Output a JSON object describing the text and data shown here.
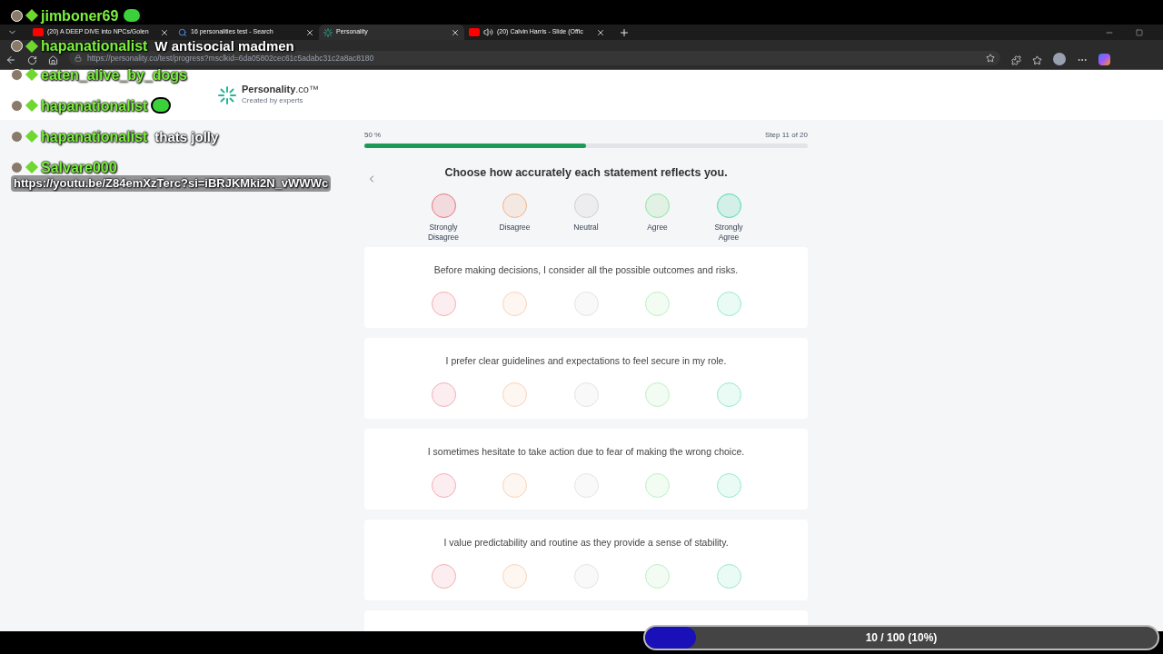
{
  "browser": {
    "tabs": [
      {
        "title": "(20) A DEEP DIVE into NPCs/Golen",
        "kind": "video",
        "selected": false
      },
      {
        "title": "16 personalities test - Search",
        "kind": "search",
        "selected": false
      },
      {
        "title": "Personality",
        "kind": "site",
        "selected": true
      },
      {
        "title": "(20) Calvin Harris - Slide (Offic",
        "kind": "video-audio",
        "selected": false
      }
    ],
    "url": "https://personality.co/test/progress?msclkid=6da05802cec61c5adabc31c2a8ac8180"
  },
  "chat": [
    {
      "user": "jimboner69",
      "emote": true
    },
    {
      "user": "hapanationalist",
      "text": "W antisocial madmen"
    },
    {
      "user": "eaten_alive_by_dogs"
    },
    {
      "user": "hapanationalist",
      "emote": true
    },
    {
      "user": "hapanationalist",
      "text": "thats jolly"
    },
    {
      "user": "Salvare000",
      "text": "https://youtu.be/Z84emXzTerc?si=iBRJKMki2N_vWWWc",
      "below": true
    }
  ],
  "page": {
    "logo": {
      "name": "Personality",
      "suffix": ".co™",
      "tagline": "Created by experts"
    },
    "progress": {
      "percent": "50 %",
      "step": "Step 11 of 20",
      "level": 0.5
    },
    "prompt": "Choose how accurately each statement reflects you.",
    "scale": [
      {
        "label": "Strongly Disagree",
        "color": "#e8737f"
      },
      {
        "label": "Disagree",
        "color": "#f1b48a"
      },
      {
        "label": "Neutral",
        "color": "#cfcfd3"
      },
      {
        "label": "Agree",
        "color": "#8fe39a"
      },
      {
        "label": "Strongly Agree",
        "color": "#4fd8a8"
      }
    ],
    "statements": [
      {
        "text": "Before making decisions, I consider all the possible outcomes and risks.",
        "options": [
          {
            "selected": false
          },
          {
            "selected": false
          },
          {
            "selected": false
          },
          {
            "selected": false
          },
          {
            "selected": false
          }
        ]
      },
      {
        "text": "I prefer clear guidelines and expectations to feel secure in my role.",
        "options": [
          {
            "selected": false
          },
          {
            "selected": false
          },
          {
            "selected": false
          },
          {
            "selected": false
          },
          {
            "selected": false
          }
        ]
      },
      {
        "text": "I sometimes hesitate to take action due to fear of making the wrong choice.",
        "options": [
          {
            "selected": false
          },
          {
            "selected": false
          },
          {
            "selected": false
          },
          {
            "selected": false
          },
          {
            "selected": false
          }
        ]
      },
      {
        "text": "I value predictability and routine as they provide a sense of stability.",
        "options": [
          {
            "selected": false
          },
          {
            "selected": false
          },
          {
            "selected": false
          },
          {
            "selected": false
          },
          {
            "selected": false
          }
        ]
      }
    ]
  },
  "goal": {
    "label": "10 / 100 (10%)",
    "level": 0.1
  }
}
